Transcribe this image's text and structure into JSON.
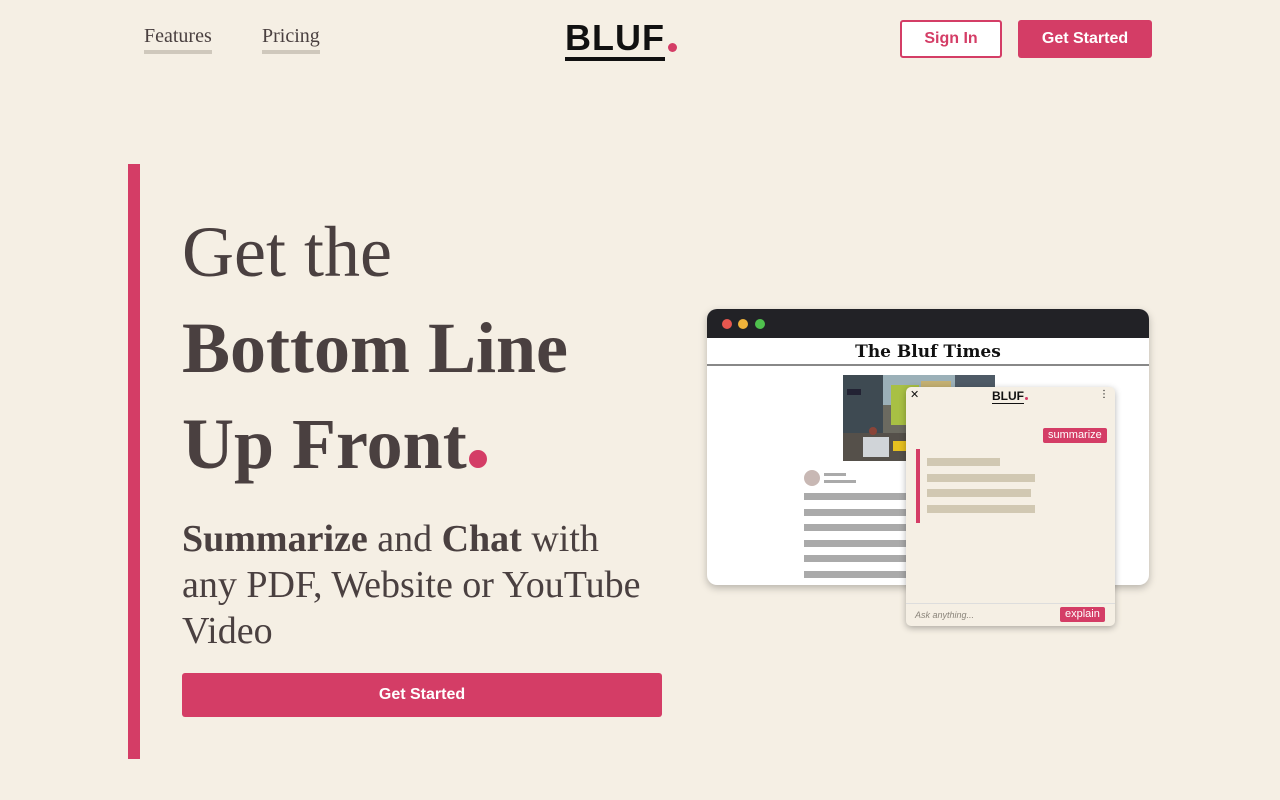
{
  "header": {
    "nav": [
      {
        "label": "Features"
      },
      {
        "label": "Pricing"
      }
    ],
    "logo_text": "BLUF",
    "sign_in_label": "Sign In",
    "get_started_label": "Get Started"
  },
  "hero": {
    "line1": "Get the",
    "line2": "Bottom Line",
    "line3": "Up Front",
    "sub_bold1": "Summarize",
    "sub_and": " and ",
    "sub_bold2": "Chat",
    "sub_rest": " with any PDF, Website or YouTube Video",
    "cta_label": "Get Started"
  },
  "mockup": {
    "newspaper_title": "The Bluf Times",
    "panel_logo": "BLUF",
    "close_glyph": "✕",
    "menu_glyph": "⋮",
    "summarize_label": "summarize",
    "input_placeholder": "Ask anything...",
    "explain_label": "explain"
  },
  "colors": {
    "accent": "#d43d66",
    "background": "#f5efe4",
    "text": "#4a4040"
  }
}
